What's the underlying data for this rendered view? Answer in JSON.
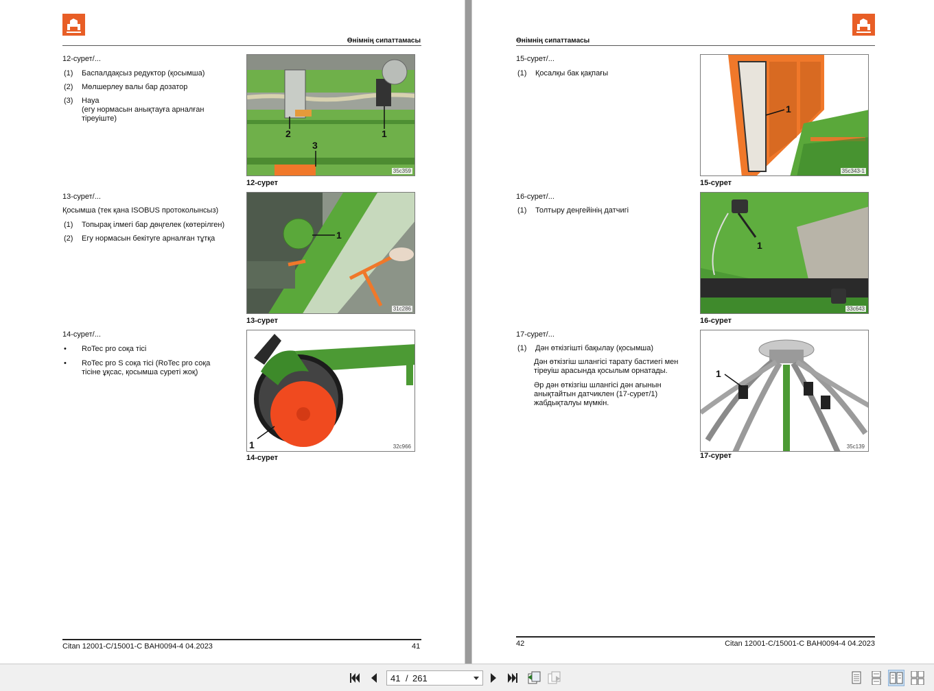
{
  "left_page": {
    "header": "Өнімнің сипаттамасы",
    "sections": [
      {
        "intro": "12-сурет/...",
        "items": [
          {
            "num": "(1)",
            "text": "Баспалдақсыз редуктор (қосымша)"
          },
          {
            "num": "(2)",
            "text": "Мөлшерлеу валы бар дозатор"
          },
          {
            "num": "(3)",
            "text_lines": [
              "Науа",
              "(егу нормасын анықтауға арналған",
              "тіреуіште)"
            ]
          }
        ],
        "figure": {
          "code": "35c359",
          "caption": "12-сурет",
          "callouts": [
            "2",
            "1",
            "3"
          ]
        }
      },
      {
        "intro": "13-сурет/...",
        "note": "Қосымша (тек қана ISOBUS протоколынсыз)",
        "items": [
          {
            "num": "(1)",
            "text": "Топырақ ілмегі бар дөңгелек (көтерілген)"
          },
          {
            "num": "(2)",
            "text": "Егу нормасын бекітуге арналған тұтқа"
          }
        ],
        "figure": {
          "code": "31c286",
          "caption": "13-сурет",
          "callouts": [
            "1"
          ]
        }
      },
      {
        "intro": "14-сурет/...",
        "bullets": [
          {
            "text": "RoTec pro соқа тісі"
          },
          {
            "text_lines": [
              "RoTec pro S соқа тісі (RoTec pro соқа",
              "тісіне ұқсас, қосымша суреті жоқ)"
            ]
          }
        ],
        "figure": {
          "code": "32c966",
          "caption": "14-сурет",
          "callouts": [
            "1"
          ]
        }
      }
    ],
    "footer": {
      "doc": "Citan 12001-C/15001-C  BAH0094-4  04.2023",
      "page": "41"
    }
  },
  "right_page": {
    "header": "Өнімнің сипаттамасы",
    "sections": [
      {
        "intro": "15-сурет/...",
        "items": [
          {
            "num": "(1)",
            "text": "Қосалқы бак қақпағы"
          }
        ],
        "figure": {
          "code": "35c343-1",
          "caption": "15-сурет",
          "callouts": [
            "1"
          ]
        }
      },
      {
        "intro": "16-сурет/...",
        "items": [
          {
            "num": "(1)",
            "text": "Толтыру деңгейінің датчигі"
          }
        ],
        "figure": {
          "code": "33c643",
          "caption": "16-сурет",
          "callouts": [
            "1"
          ]
        }
      },
      {
        "intro": "17-сурет/...",
        "items": [
          {
            "num": "(1)",
            "text": "Дән өткізгішті бақылау (қосымша)"
          }
        ],
        "paragraphs": [
          [
            "Дән өткізгіш шлангісі тарату бастиегі мен",
            "тіреуіш арасында қосылым орнатады."
          ],
          [
            "Әр дән өткізгіш шлангісі дән ағынын",
            "анықтайтын датчиклен (17-сурет/1)",
            "жабдықталуы мүмкін."
          ]
        ],
        "figure": {
          "code": "35c139",
          "caption": "17-сурет",
          "callouts": [
            "1"
          ]
        }
      }
    ],
    "footer": {
      "doc": "Citan 12001-C/15001-C  BAH0094-4  04.2023",
      "page": "42"
    }
  },
  "toolbar": {
    "current_page": "41",
    "separator": "/",
    "total_pages": "261",
    "buttons": [
      "first-page-icon",
      "previous-page-icon",
      "next-page-icon",
      "last-page-icon",
      "previous-view-icon",
      "next-view-icon"
    ],
    "view_modes": [
      "single-page-icon",
      "continuous-page-icon",
      "facing-pages-icon",
      "continuous-facing-icon"
    ],
    "active_view": "facing-pages-icon"
  },
  "colors": {
    "brand_orange": "#e85e26",
    "machine_green": "#5aa83a",
    "part_orange": "#f0782a"
  }
}
